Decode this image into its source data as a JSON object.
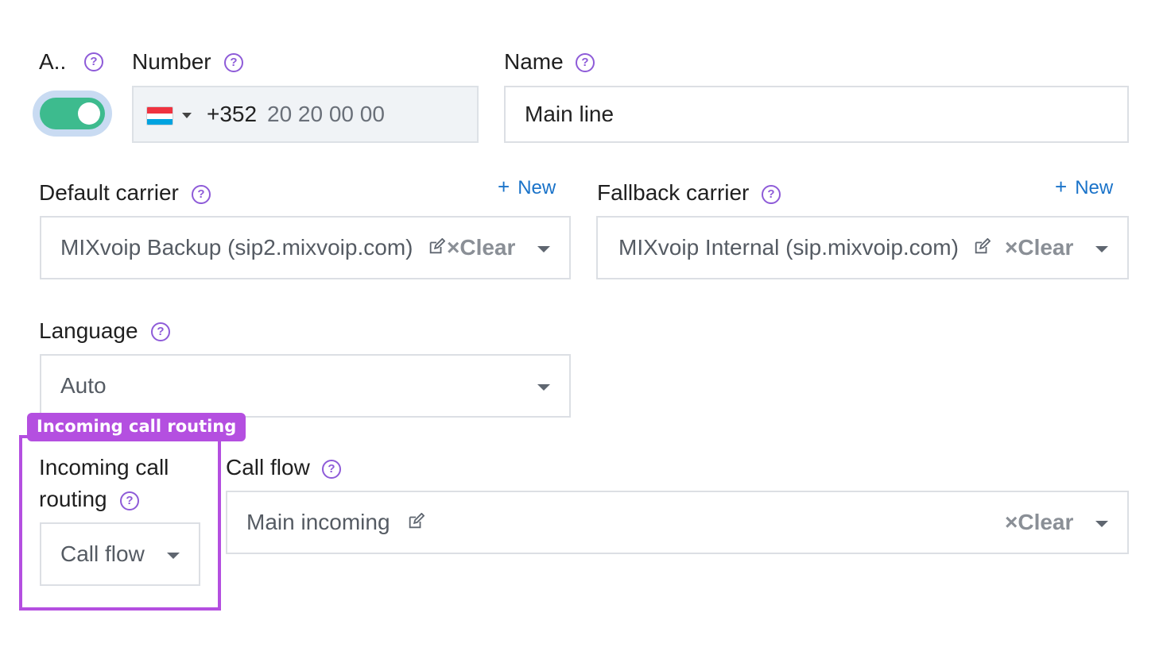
{
  "active": {
    "label": "A..",
    "enabled": true
  },
  "number": {
    "label": "Number",
    "country_prefix": "+352",
    "value": "20 20 00 00",
    "flag_icon": "luxembourg-flag-icon"
  },
  "name": {
    "label": "Name",
    "value": "Main line"
  },
  "default_carrier": {
    "label": "Default carrier",
    "new_label": "New",
    "value": "MIXvoip Backup (sip2.mixvoip.com)",
    "clear_label": "×Clear"
  },
  "fallback_carrier": {
    "label": "Fallback carrier",
    "new_label": "New",
    "value": "MIXvoip Internal (sip.mixvoip.com)",
    "clear_label": "×Clear"
  },
  "language": {
    "label": "Language",
    "value": "Auto"
  },
  "incoming_routing": {
    "tag": "Incoming call routing",
    "label_line1": "Incoming call",
    "label_line2": "routing",
    "value": "Call flow"
  },
  "call_flow": {
    "label": "Call flow",
    "value": "Main incoming",
    "clear_label": "×Clear"
  },
  "colors": {
    "toggle_on": "#3dbb8e",
    "accent_purple": "#b44fe0",
    "help_purple": "#8e5bd8",
    "link_blue": "#1a73c9"
  }
}
